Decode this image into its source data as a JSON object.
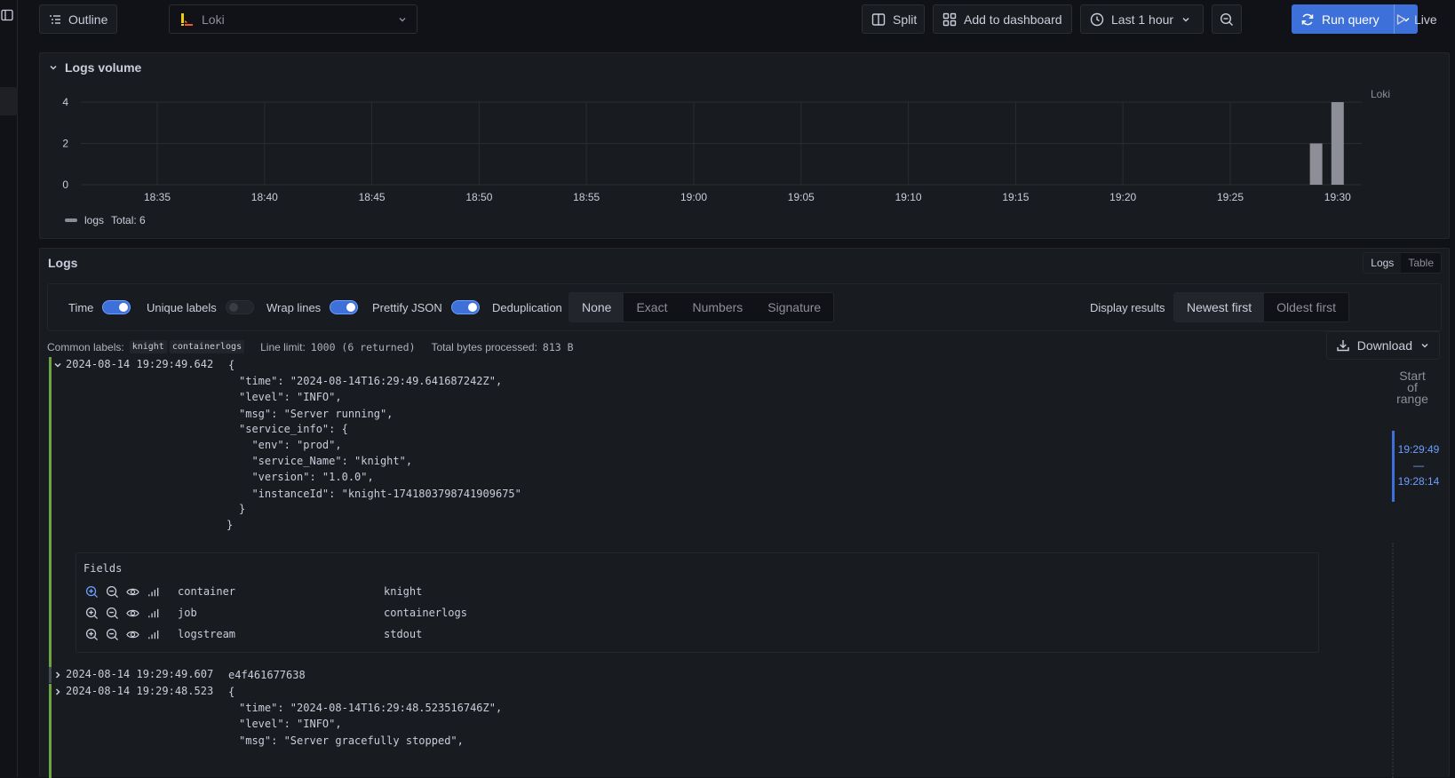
{
  "toolbar": {
    "outline_label": "Outline",
    "datasource": "Loki",
    "split_label": "Split",
    "add_dashboard_label": "Add to dashboard",
    "time_range": "Last 1 hour",
    "run_query_label": "Run query",
    "live_label": "Live"
  },
  "logs_volume": {
    "title": "Logs volume",
    "legend_name": "logs",
    "legend_total": "Total: 6",
    "series_label": "Loki"
  },
  "chart_data": {
    "type": "bar",
    "title": "Logs volume",
    "x_ticks": [
      "18:35",
      "18:40",
      "18:45",
      "18:50",
      "18:55",
      "19:00",
      "19:05",
      "19:10",
      "19:15",
      "19:20",
      "19:25",
      "19:30"
    ],
    "y_ticks": [
      0,
      2,
      4
    ],
    "ylim": [
      0,
      4
    ],
    "series": [
      {
        "name": "logs",
        "color": "#8e8e99",
        "points": [
          {
            "x": "19:29",
            "y": 2
          },
          {
            "x": "19:30",
            "y": 4
          }
        ]
      }
    ],
    "grid": true,
    "legend": "bottom-left"
  },
  "logs": {
    "title": "Logs",
    "view_logs": "Logs",
    "view_table": "Table",
    "options": {
      "time": "Time",
      "unique_labels": "Unique labels",
      "wrap_lines": "Wrap lines",
      "prettify_json": "Prettify JSON",
      "deduplication": "Deduplication",
      "dedup_options": [
        "None",
        "Exact",
        "Numbers",
        "Signature"
      ],
      "display_results": "Display results",
      "order_options": [
        "Newest first",
        "Oldest first"
      ]
    },
    "meta": {
      "common_labels_label": "Common labels:",
      "common_labels": [
        "knight",
        "containerlogs"
      ],
      "line_limit_label": "Line limit:",
      "line_limit_value": "1000 (6 returned)",
      "bytes_label": "Total bytes processed:",
      "bytes_value": "813 B"
    },
    "download_label": "Download",
    "range_nav": {
      "start": "Start of range",
      "from": "19:29:49",
      "dash": "—",
      "to": "19:28:14"
    },
    "rows": [
      {
        "timestamp": "2024-08-14 19:29:49.642",
        "body_first": "{",
        "json_lines": [
          "\"time\": \"2024-08-14T16:29:49.641687242Z\",",
          "\"level\": \"INFO\",",
          "\"msg\": \"Server running\",",
          "\"service_info\": {",
          "  \"env\": \"prod\",",
          "  \"service_Name\": \"knight\",",
          "  \"version\": \"1.0.0\",",
          "  \"instanceId\": \"knight-1741803798741909675\"",
          "}",
          "}"
        ]
      },
      {
        "timestamp": "2024-08-14 19:29:49.607",
        "body_first": "e4f461677638"
      },
      {
        "timestamp": "2024-08-14 19:29:48.523",
        "body_first": "{",
        "json_lines": [
          "\"time\": \"2024-08-14T16:29:48.523516746Z\",",
          "\"level\": \"INFO\",",
          "\"msg\": \"Server gracefully stopped\","
        ]
      }
    ],
    "fields": {
      "title": "Fields",
      "items": [
        {
          "key": "container",
          "value": "knight"
        },
        {
          "key": "job",
          "value": "containerlogs"
        },
        {
          "key": "logstream",
          "value": "stdout"
        }
      ]
    }
  }
}
